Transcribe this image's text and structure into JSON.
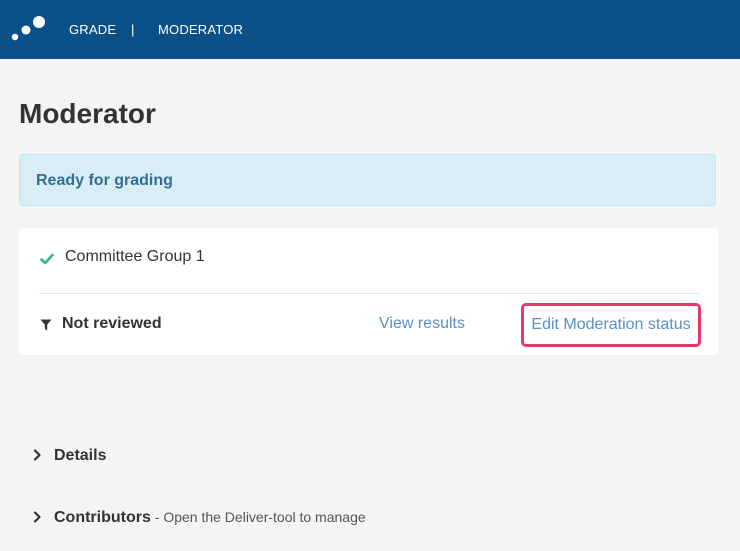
{
  "header": {
    "logo_icon": "dots-logo-icon",
    "nav": {
      "grade": "GRADE",
      "separator": "|",
      "moderator": "MODERATOR"
    }
  },
  "page": {
    "title": "Moderator"
  },
  "status_banner": {
    "text": "Ready for grading"
  },
  "group_card": {
    "check_icon": "check-icon",
    "group_name": "Committee Group 1",
    "filter_icon": "filter-icon",
    "review_status": "Not reviewed",
    "view_results_label": "View results",
    "edit_moderation_label": "Edit Moderation status"
  },
  "sections": {
    "details": {
      "title": "Details"
    },
    "contributors": {
      "title": "Contributors",
      "note": " - Open the Deliver-tool to manage"
    }
  },
  "colors": {
    "topbar": "#0b5086",
    "banner_bg": "#d9edf7",
    "banner_text": "#31708f",
    "link": "#5b8fc0",
    "highlight": "#e8396a",
    "check": "#2fb57c"
  }
}
